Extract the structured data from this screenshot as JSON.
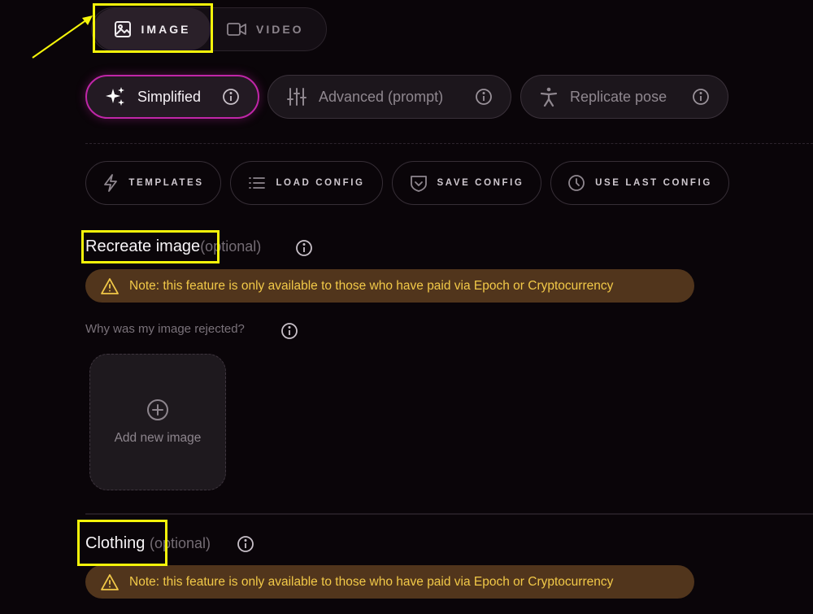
{
  "media_toggle": {
    "image_label": "IMAGE",
    "video_label": "VIDEO",
    "image_icon": "image-icon",
    "video_icon": "video-camera-icon"
  },
  "mode_tabs": [
    {
      "label": "Simplified",
      "icon": "sparkles-icon",
      "active": true
    },
    {
      "label": "Advanced (prompt)",
      "icon": "sliders-icon",
      "active": false
    },
    {
      "label": "Replicate pose",
      "icon": "person-pose-icon",
      "active": false
    }
  ],
  "config_buttons": [
    {
      "label": "TEMPLATES",
      "icon": "lightning-icon"
    },
    {
      "label": "LOAD CONFIG",
      "icon": "list-icon"
    },
    {
      "label": "SAVE CONFIG",
      "icon": "save-shield-icon"
    },
    {
      "label": "USE LAST CONFIG",
      "icon": "clock-icon"
    }
  ],
  "recreate_section": {
    "title": "Recreate image",
    "optional": "(optional)",
    "note": "Note: this feature is only available to those who have paid via Epoch or Cryptocurrency",
    "why_rejected": "Why was my image rejected?",
    "add_image_label": "Add new image"
  },
  "clothing_section": {
    "title": "Clothing",
    "optional": "(optional)",
    "note": "Note: this feature is only available to those who have paid via Epoch or Cryptocurrency"
  },
  "colors": {
    "background": "#0a0509",
    "accent_pink": "#c026a8",
    "note_background": "#51351c",
    "note_text": "#f2c948",
    "highlight_yellow": "#f5f50a"
  }
}
